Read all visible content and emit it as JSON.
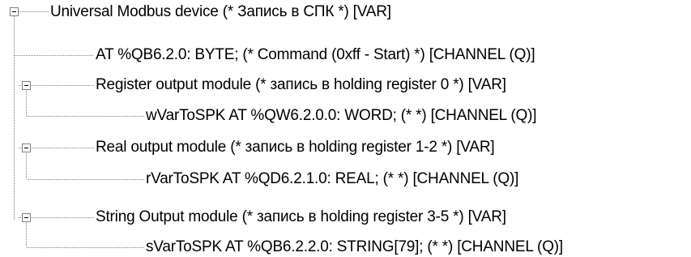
{
  "tree": {
    "root": {
      "label": "Universal Modbus device (* Запись в СПК *) [VAR]",
      "expanded": true
    },
    "children": [
      {
        "label": "AT %QB6.2.0: BYTE; (* Command (0xff - Start) *) [CHANNEL (Q)]"
      },
      {
        "label": "Register output module (* запись в holding register 0 *) [VAR]",
        "expanded": true,
        "children": [
          {
            "label": "wVarToSPK AT %QW6.2.0.0: WORD; (*  *) [CHANNEL (Q)]"
          }
        ]
      },
      {
        "label": "Real output module (* запись в holding register 1-2 *) [VAR]",
        "expanded": true,
        "children": [
          {
            "label": "rVarToSPK AT %QD6.2.1.0: REAL; (*  *) [CHANNEL (Q)]"
          }
        ]
      },
      {
        "label": "String Output module (* запись в holding register 3-5 *) [VAR]",
        "expanded": true,
        "children": [
          {
            "label": "sVarToSPK AT %QB6.2.2.0: STRING[79]; (*  *) [CHANNEL (Q)]"
          }
        ]
      }
    ]
  },
  "colors": {
    "tree_line": "#808080",
    "text": "#000000",
    "background": "#ffffff"
  }
}
